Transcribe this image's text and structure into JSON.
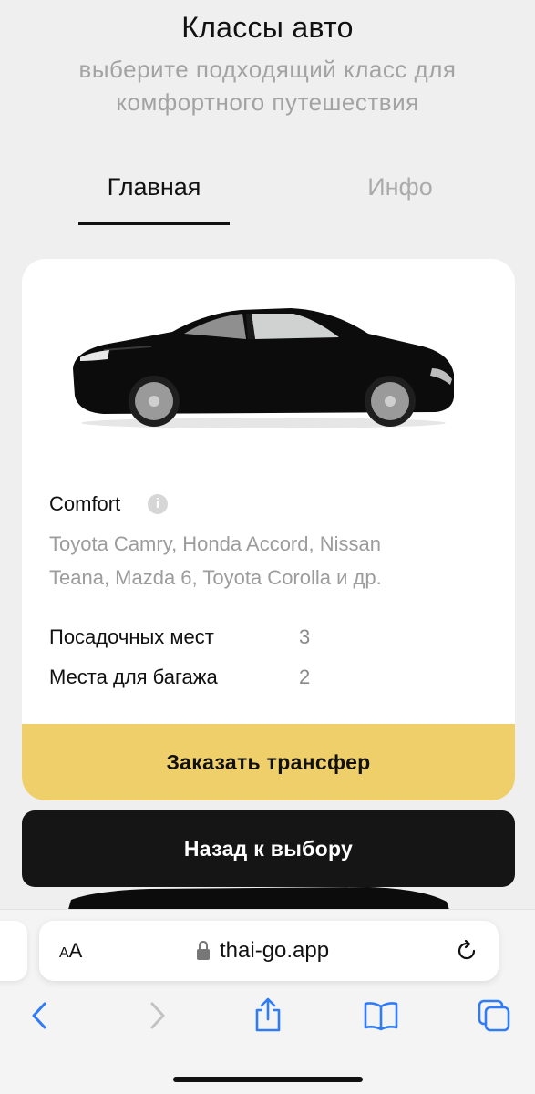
{
  "header": {
    "title": "Классы авто",
    "subtitle_line1": "выберите подходящий класс для",
    "subtitle_line2": "комфортного путешествия"
  },
  "tabs": [
    {
      "label": "Главная",
      "active": true
    },
    {
      "label": "Инфо",
      "active": false
    }
  ],
  "car_card": {
    "image": "black-sedan-side-view",
    "class_name": "Comfort",
    "models_line1": "Toyota Camry, Honda Accord, Nissan",
    "models_line2": "Teana, Mazda 6, Toyota Corolla и др.",
    "specs": [
      {
        "label": "Посадочных мест",
        "value": "3"
      },
      {
        "label": "Места для багажа",
        "value": "2"
      }
    ],
    "order_button": "Заказать трансфер"
  },
  "back_button": "Назад к выбору",
  "browser": {
    "aa_label_small": "A",
    "aa_label_large": "A",
    "url": "thai-go.app",
    "icons": [
      "lock-icon",
      "reload-icon",
      "back-icon",
      "forward-icon",
      "share-icon",
      "bookmarks-icon",
      "tabs-icon"
    ]
  },
  "colors": {
    "background": "#efefef",
    "accent_yellow": "#efcf6a",
    "dark_button": "#151515",
    "muted_text": "#9c9c9c"
  }
}
